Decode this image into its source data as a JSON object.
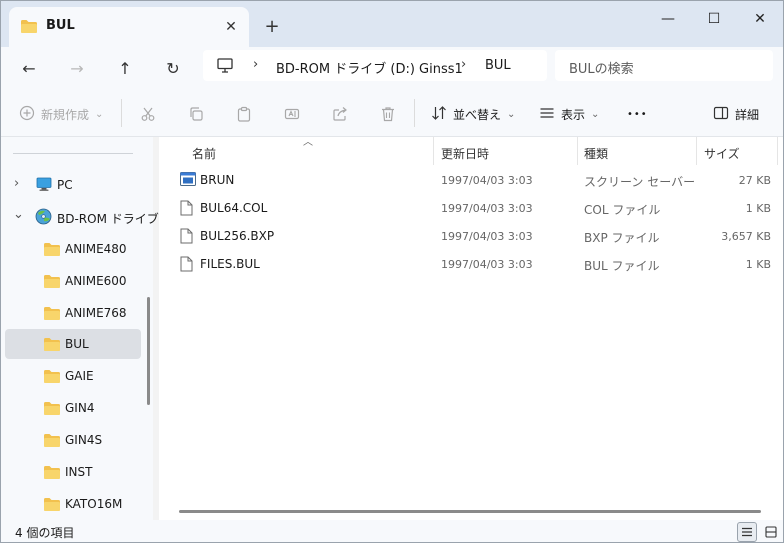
{
  "tab": {
    "title": "BUL",
    "close": "✕",
    "new_tab": "+"
  },
  "window_controls": {
    "minimize": "—",
    "maximize": "☐",
    "close": "✕"
  },
  "nav": {
    "back": "←",
    "forward": "→",
    "up": "↑",
    "refresh": "↻"
  },
  "address": {
    "sep": "›",
    "crumbs": [
      "BD-ROM ドライブ (D:) Ginss1",
      "BUL"
    ]
  },
  "search": {
    "placeholder": "BULの検索"
  },
  "toolbar": {
    "new_label": "新規作成",
    "sort_label": "並べ替え",
    "view_label": "表示",
    "more_label": "•••",
    "details_label": "詳細",
    "dropdown": "⌄"
  },
  "sidebar": {
    "items": [
      {
        "label": "PC",
        "expander": "›"
      },
      {
        "label": "BD-ROM ドライブ",
        "expander": "⌄"
      },
      {
        "label": "ANIME480"
      },
      {
        "label": "ANIME600"
      },
      {
        "label": "ANIME768"
      },
      {
        "label": "BUL",
        "selected": true
      },
      {
        "label": "GAIE"
      },
      {
        "label": "GIN4"
      },
      {
        "label": "GIN4S"
      },
      {
        "label": "INST"
      },
      {
        "label": "KATO16M"
      }
    ]
  },
  "columns": {
    "name": "名前",
    "date": "更新日時",
    "type": "種類",
    "size": "サイズ",
    "sort_caret": "︿"
  },
  "files": [
    {
      "name": "BRUN",
      "date": "1997/04/03 3:03",
      "type": "スクリーン セーバー",
      "size": "27 KB",
      "icon": "screensaver-icon"
    },
    {
      "name": "BUL64.COL",
      "date": "1997/04/03 3:03",
      "type": "COL ファイル",
      "size": "1 KB",
      "icon": "file-icon"
    },
    {
      "name": "BUL256.BXP",
      "date": "1997/04/03 3:03",
      "type": "BXP ファイル",
      "size": "3,657 KB",
      "icon": "file-icon"
    },
    {
      "name": "FILES.BUL",
      "date": "1997/04/03 3:03",
      "type": "BUL ファイル",
      "size": "1 KB",
      "icon": "file-icon"
    }
  ],
  "status": {
    "count": "4 個の項目"
  },
  "colors": {
    "folder": "#f2c14e",
    "accent": "#0067c0",
    "titlebar": "#dde6f2",
    "selected": "#dcdfe4"
  }
}
